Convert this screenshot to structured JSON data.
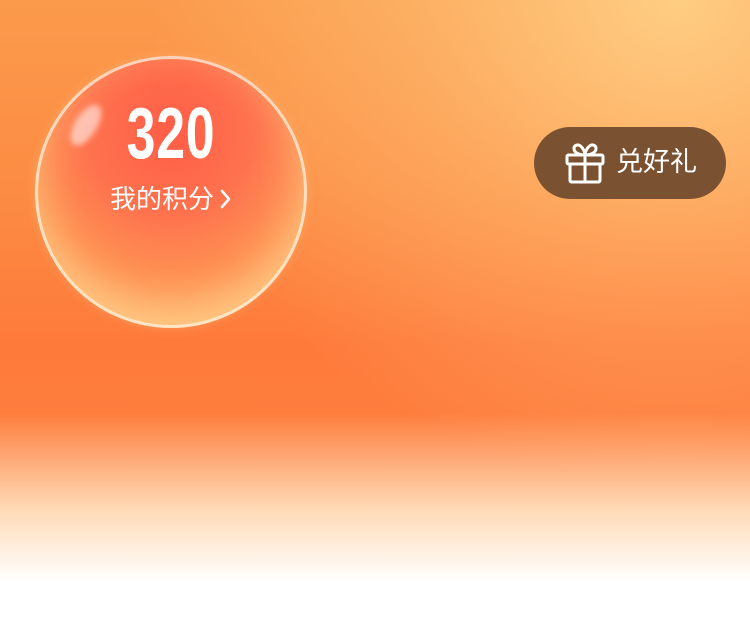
{
  "points": {
    "value": "320",
    "label": "我的积分",
    "chevron_icon": "chevron-right-icon"
  },
  "redeem": {
    "label": "兑好礼",
    "icon": "gift-icon",
    "background_color": "#7b5231"
  },
  "colors": {
    "background_top": "#fb9a4b",
    "background_mid": "#fe7a3b",
    "background_bottom": "#ffffff",
    "text": "#ffffff"
  }
}
